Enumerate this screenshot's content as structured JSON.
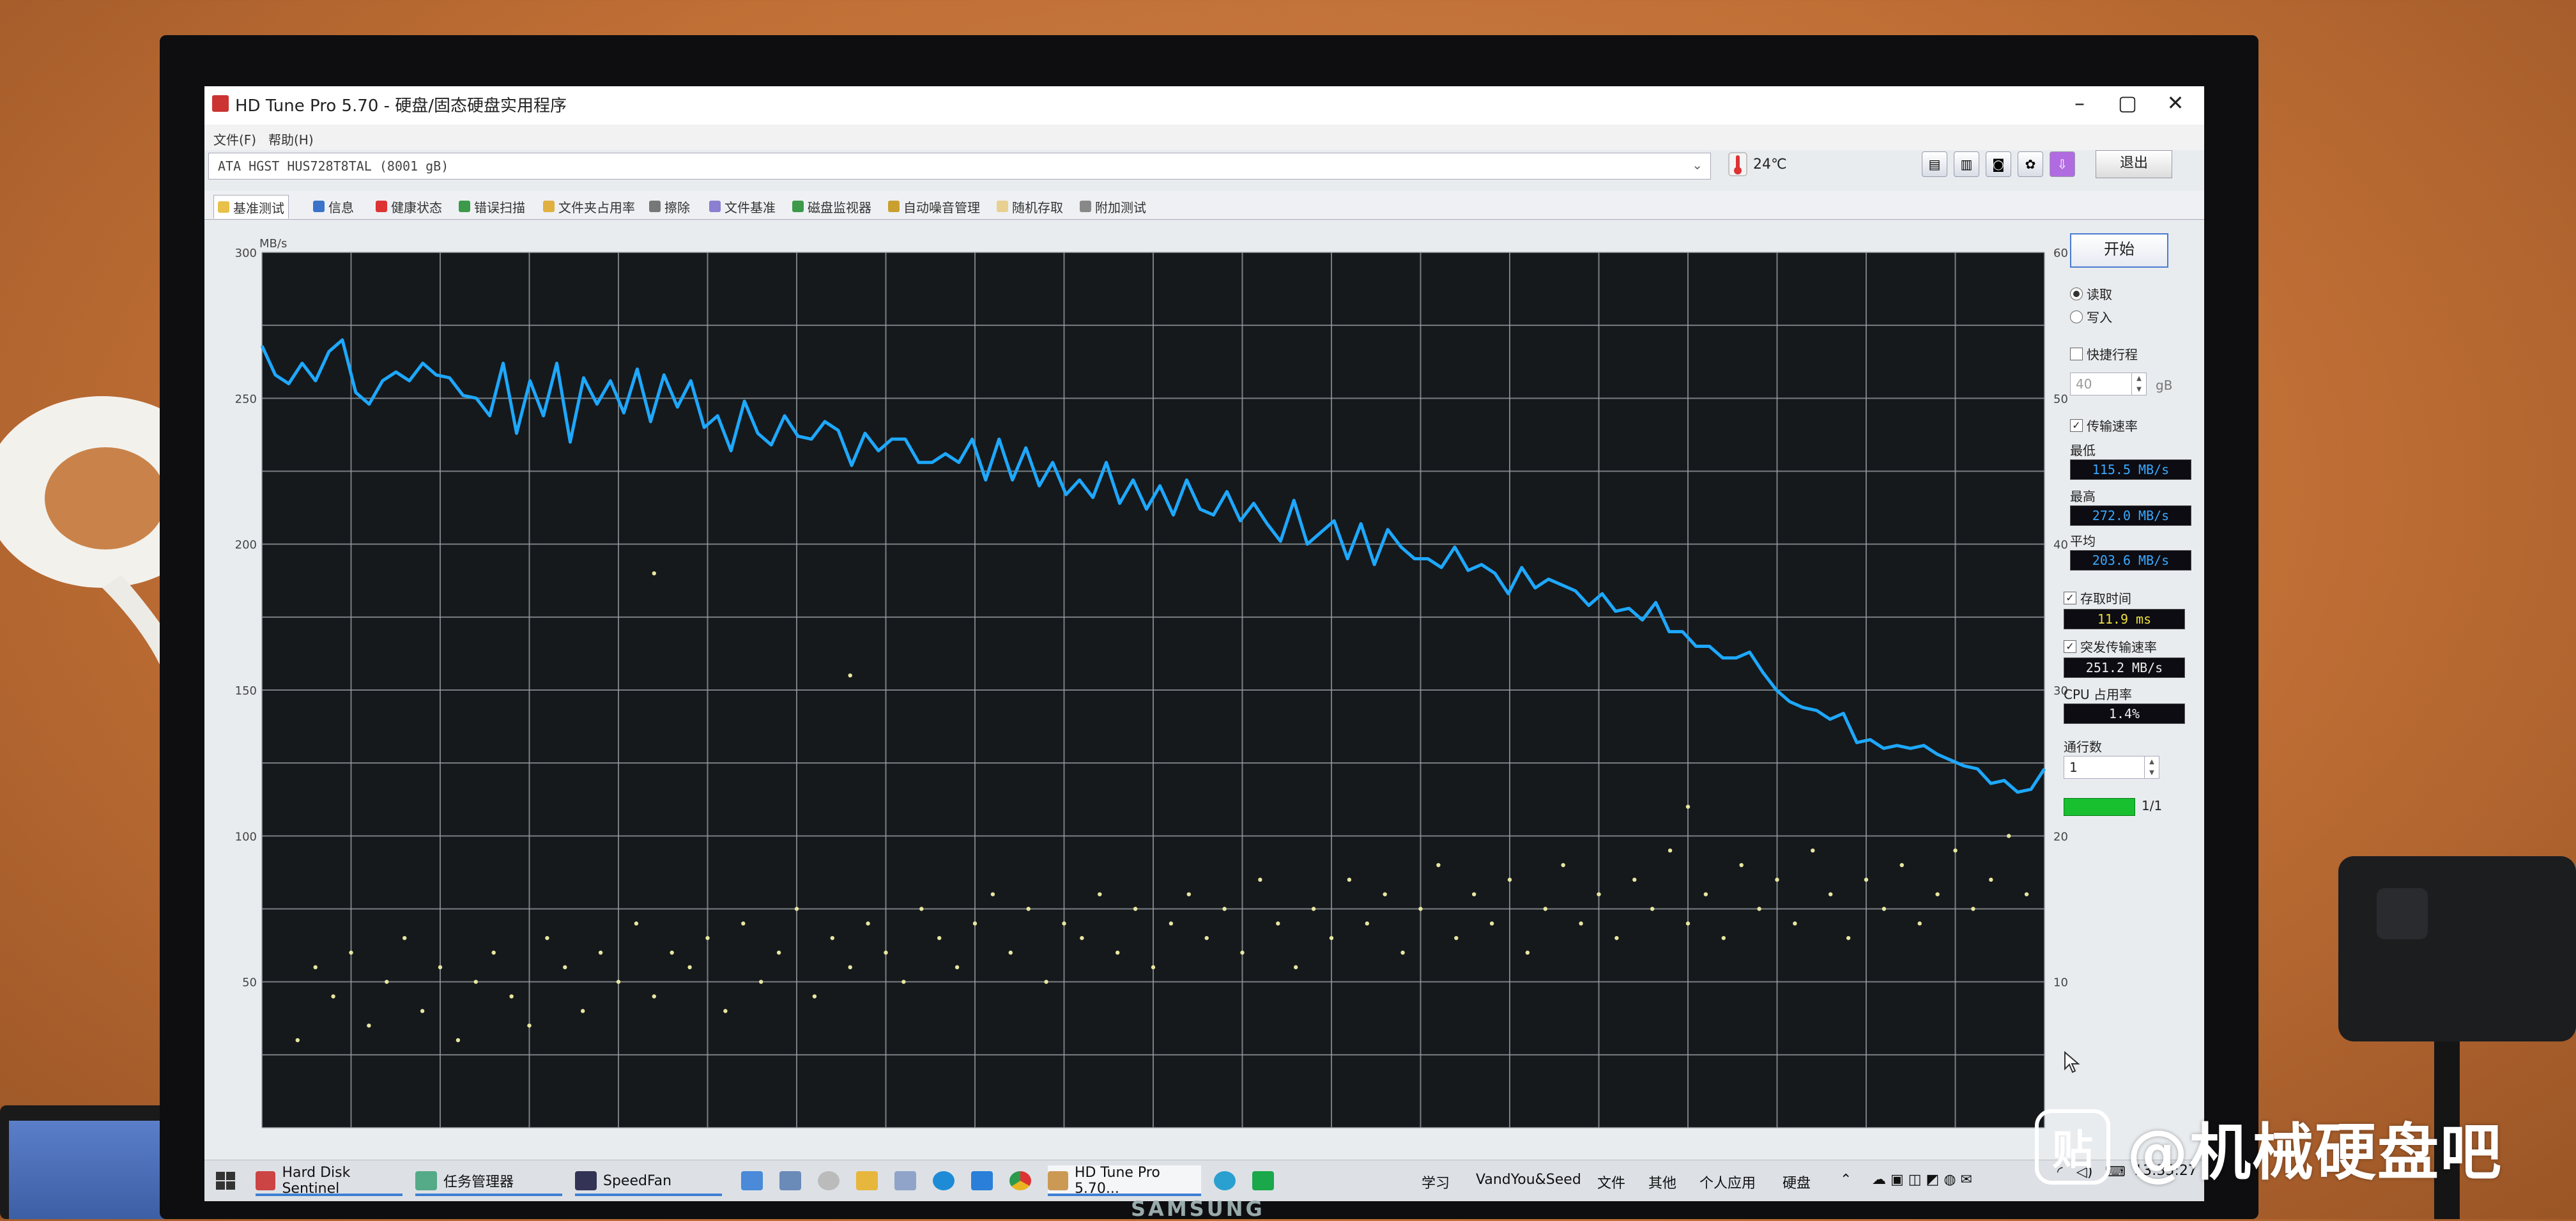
{
  "window": {
    "title": "HD Tune Pro 5.70 - 硬盘/固态硬盘实用程序",
    "menus": [
      "文件(F)",
      "帮助(H)"
    ]
  },
  "drive": {
    "selected": "ATA     HGST HUS728T8TAL (8001 gB)",
    "temperature": "24℃"
  },
  "toolbar": {
    "exit_label": "退出"
  },
  "tabs": [
    "基准测试",
    "信息",
    "健康状态",
    "错误扫描",
    "文件夹占用率",
    "擦除",
    "文件基准",
    "磁盘监视器",
    "自动噪音管理",
    "随机存取",
    "附加测试"
  ],
  "panel": {
    "start_label": "开始",
    "read_label": "读取",
    "write_label": "写入",
    "short_stroke_label": "快捷行程",
    "short_stroke_value": "40",
    "short_stroke_unit": "gB",
    "transfer_rate_label": "传输速率",
    "min_label": "最低",
    "min_value": "115.5 MB/s",
    "max_label": "最高",
    "max_value": "272.0 MB/s",
    "avg_label": "平均",
    "avg_value": "203.6 MB/s",
    "access_time_label": "存取时间",
    "access_time_value": "11.9 ms",
    "burst_label": "突发传输速率",
    "burst_value": "251.2 MB/s",
    "cpu_label": "CPU 占用率",
    "cpu_value": "1.4%",
    "passes_label": "通行数",
    "passes_value": "1",
    "progress_text": "1/1",
    "progress": 1.0
  },
  "taskbar": {
    "apps": [
      "Hard Disk Sentinel",
      "任务管理器",
      "SpeedFan",
      "HD Tune Pro 5.70..."
    ],
    "toolbars": [
      "学习",
      "VandYou&Seed",
      "文件",
      "其他",
      "个人应用",
      "硬盘"
    ],
    "clock": "13:35:27"
  },
  "monitor_brand": "SAMSUNG",
  "watermark": {
    "badge": "贴",
    "text": "@机械硬盘吧"
  },
  "colors": {
    "transfer": "#1ea8ff",
    "access": "#e8e6a0",
    "grid": "#9aa0a4",
    "chart_bg": "#15191c"
  },
  "chart_data": {
    "type": "line",
    "left_axis": {
      "unit": "MB/s",
      "min": 0,
      "max": 300,
      "ticks": [
        300,
        250,
        200,
        150,
        100,
        50
      ]
    },
    "right_axis": {
      "unit": "ms",
      "min": 0,
      "max": 60,
      "ticks": [
        60,
        50,
        40,
        30,
        20,
        10
      ]
    },
    "x_range": [
      0,
      100
    ],
    "series": [
      {
        "kind": "transfer-rate",
        "values": [
          268,
          258,
          255,
          262,
          256,
          266,
          270,
          252,
          248,
          256,
          259,
          256,
          262,
          258,
          257,
          251,
          250,
          244,
          262,
          238,
          256,
          244,
          262,
          235,
          257,
          248,
          256,
          245,
          260,
          242,
          258,
          247,
          256,
          240,
          244,
          232,
          249,
          238,
          234,
          244,
          237,
          236,
          242,
          239,
          227,
          238,
          232,
          236,
          236,
          228,
          228,
          231,
          228,
          236,
          222,
          236,
          222,
          233,
          220,
          228,
          217,
          222,
          216,
          228,
          214,
          222,
          212,
          220,
          210,
          222,
          212,
          210,
          218,
          208,
          214,
          207,
          201,
          215,
          200,
          204,
          208,
          195,
          207,
          193,
          205,
          199,
          195,
          195,
          192,
          199,
          191,
          193,
          190,
          183,
          192,
          185,
          188,
          186,
          184,
          179,
          183,
          177,
          178,
          174,
          180,
          170,
          170,
          165,
          165,
          161,
          161,
          163,
          156,
          150,
          146,
          144,
          143,
          140,
          142,
          132,
          133,
          130,
          131,
          130,
          131,
          128,
          126,
          124,
          123,
          118,
          119,
          115,
          116,
          123
        ]
      },
      {
        "kind": "access-time",
        "unit": "ms",
        "points": [
          [
            2,
            6
          ],
          [
            3,
            11
          ],
          [
            4,
            9
          ],
          [
            5,
            12
          ],
          [
            6,
            7
          ],
          [
            7,
            10
          ],
          [
            8,
            13
          ],
          [
            9,
            8
          ],
          [
            10,
            11
          ],
          [
            11,
            6
          ],
          [
            12,
            10
          ],
          [
            13,
            12
          ],
          [
            14,
            9
          ],
          [
            15,
            7
          ],
          [
            16,
            13
          ],
          [
            17,
            11
          ],
          [
            18,
            8
          ],
          [
            19,
            12
          ],
          [
            20,
            10
          ],
          [
            21,
            14
          ],
          [
            22,
            9
          ],
          [
            23,
            12
          ],
          [
            24,
            11
          ],
          [
            25,
            13
          ],
          [
            26,
            8
          ],
          [
            27,
            14
          ],
          [
            28,
            10
          ],
          [
            29,
            12
          ],
          [
            30,
            15
          ],
          [
            31,
            9
          ],
          [
            32,
            13
          ],
          [
            33,
            11
          ],
          [
            34,
            14
          ],
          [
            35,
            12
          ],
          [
            36,
            10
          ],
          [
            37,
            15
          ],
          [
            38,
            13
          ],
          [
            39,
            11
          ],
          [
            40,
            14
          ],
          [
            41,
            16
          ],
          [
            42,
            12
          ],
          [
            43,
            15
          ],
          [
            44,
            10
          ],
          [
            45,
            14
          ],
          [
            46,
            13
          ],
          [
            47,
            16
          ],
          [
            48,
            12
          ],
          [
            49,
            15
          ],
          [
            50,
            11
          ],
          [
            51,
            14
          ],
          [
            52,
            16
          ],
          [
            53,
            13
          ],
          [
            54,
            15
          ],
          [
            55,
            12
          ],
          [
            56,
            17
          ],
          [
            57,
            14
          ],
          [
            58,
            11
          ],
          [
            59,
            15
          ],
          [
            60,
            13
          ],
          [
            61,
            17
          ],
          [
            62,
            14
          ],
          [
            63,
            16
          ],
          [
            64,
            12
          ],
          [
            65,
            15
          ],
          [
            66,
            18
          ],
          [
            67,
            13
          ],
          [
            68,
            16
          ],
          [
            69,
            14
          ],
          [
            70,
            17
          ],
          [
            71,
            12
          ],
          [
            72,
            15
          ],
          [
            73,
            18
          ],
          [
            74,
            14
          ],
          [
            75,
            16
          ],
          [
            76,
            13
          ],
          [
            77,
            17
          ],
          [
            78,
            15
          ],
          [
            79,
            19
          ],
          [
            80,
            14
          ],
          [
            81,
            16
          ],
          [
            82,
            13
          ],
          [
            83,
            18
          ],
          [
            84,
            15
          ],
          [
            85,
            17
          ],
          [
            86,
            14
          ],
          [
            87,
            19
          ],
          [
            88,
            16
          ],
          [
            89,
            13
          ],
          [
            90,
            17
          ],
          [
            91,
            15
          ],
          [
            92,
            18
          ],
          [
            93,
            14
          ],
          [
            94,
            16
          ],
          [
            95,
            19
          ],
          [
            96,
            15
          ],
          [
            97,
            17
          ],
          [
            98,
            20
          ],
          [
            99,
            16
          ],
          [
            22,
            38
          ],
          [
            33,
            31
          ],
          [
            80,
            22
          ]
        ]
      }
    ]
  }
}
